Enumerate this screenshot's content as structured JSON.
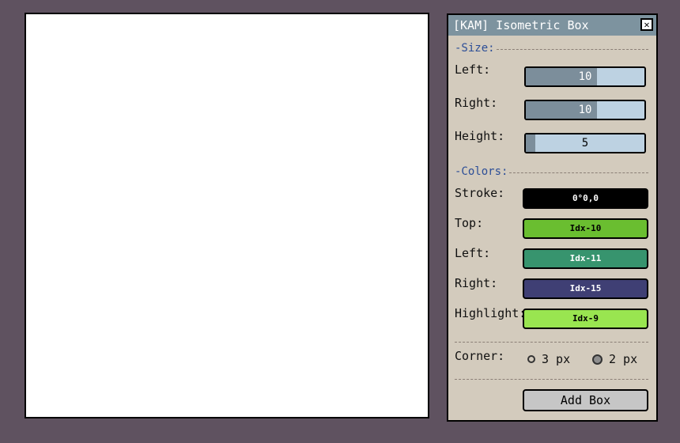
{
  "dialog": {
    "title": "[KAM] Isometric Box",
    "close_glyph": "✕"
  },
  "size": {
    "heading": "-Size:",
    "left": {
      "label": "Left:",
      "value": "10",
      "fill": 0.6
    },
    "right": {
      "label": "Right:",
      "value": "10",
      "fill": 0.6
    },
    "height": {
      "label": "Height:",
      "value": "5",
      "fill": 0.08
    }
  },
  "colors": {
    "heading": "-Colors:",
    "stroke": {
      "label": "Stroke:",
      "value": "0°0,0",
      "color": "#000000",
      "text_color": "#ffffff"
    },
    "top": {
      "label": "Top:",
      "value": "Idx-10",
      "color": "#6abe30",
      "text_color": "#000000"
    },
    "left": {
      "label": "Left:",
      "value": "Idx-11",
      "color": "#37946e",
      "text_color": "#ffffff"
    },
    "right": {
      "label": "Right:",
      "value": "Idx-15",
      "color": "#3f3f74",
      "text_color": "#ffffff"
    },
    "highlight": {
      "label": "Highlight:",
      "value": "Idx-9",
      "color": "#99e550",
      "text_color": "#000000"
    }
  },
  "corner": {
    "label": "Corner:",
    "options": [
      {
        "label": "3 px",
        "selected": false
      },
      {
        "label": "2 px",
        "selected": true
      }
    ]
  },
  "actions": {
    "add_box_label": "Add Box"
  }
}
